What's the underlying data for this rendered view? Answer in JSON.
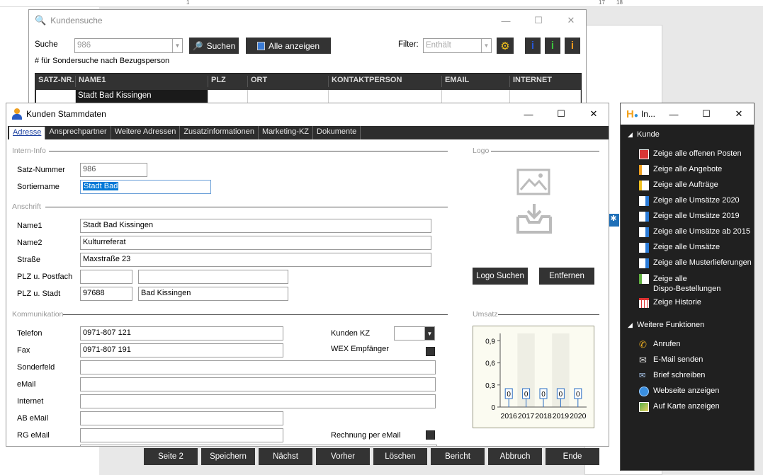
{
  "ruler": {
    "marks": [
      "1",
      "17",
      "18"
    ]
  },
  "search_window": {
    "title": "Kundensuche",
    "search_label": "Suche",
    "search_value": "986",
    "search_button": "Suchen",
    "show_all_button": "Alle anzeigen",
    "filter_label": "Filter:",
    "filter_value": "Enthält",
    "hint": "# für Sondersuche nach Bezugsperson",
    "grid": {
      "columns": [
        "SATZ-NR.",
        "NAME1",
        "PLZ",
        "ORT",
        "KONTAKTPERSON",
        "EMAIL",
        "INTERNET"
      ],
      "row": [
        "",
        "Stadt Bad Kissingen",
        "",
        "",
        "",
        "",
        ""
      ]
    }
  },
  "stamm_window": {
    "title": "Kunden Stammdaten",
    "tabs": [
      "Adresse",
      "Ansprechpartner",
      "Weitere Adressen",
      "Zusatzinformationen",
      "Marketing-KZ",
      "Dokumente"
    ],
    "sections": {
      "intern": "Intern-Info",
      "anschrift": "Anschrift",
      "kommunikation": "Kommunikation",
      "logo": "Logo",
      "umsatz": "Umsatz"
    },
    "fields": {
      "satz_nummer": {
        "label": "Satz-Nummer",
        "value": "986"
      },
      "sortiername": {
        "label": "Sortiername",
        "value": "Stadt Bad"
      },
      "name1": {
        "label": "Name1",
        "value": "Stadt Bad Kissingen"
      },
      "name2": {
        "label": "Name2",
        "value": "Kulturreferat"
      },
      "strasse": {
        "label": "Straße",
        "value": "Maxstraße 23"
      },
      "plz_postfach": {
        "label": "PLZ u. Postfach",
        "value": "",
        "value2": ""
      },
      "plz_stadt": {
        "label": "PLZ u. Stadt",
        "value": "97688",
        "value2": "Bad Kissingen"
      },
      "telefon": {
        "label": "Telefon",
        "value": "0971-807 121"
      },
      "fax": {
        "label": "Fax",
        "value": "0971-807 191"
      },
      "sonderfeld": {
        "label": "Sonderfeld",
        "value": ""
      },
      "email": {
        "label": "eMail",
        "value": ""
      },
      "internet": {
        "label": "Internet",
        "value": ""
      },
      "ab_email": {
        "label": "AB eMail",
        "value": ""
      },
      "rg_email": {
        "label": "RG eMail",
        "value": ""
      },
      "kunden_kz": {
        "label": "Kunden KZ",
        "value": ""
      },
      "wex": {
        "label": "WEX Empfänger"
      },
      "rechnung_email": {
        "label": "Rechnung per eMail"
      }
    },
    "logo_search_button": "Logo Suchen",
    "remove_button": "Entfernen"
  },
  "chart_data": {
    "type": "bar",
    "categories": [
      "2016",
      "2017",
      "2018",
      "2019",
      "2020"
    ],
    "values": [
      0,
      0,
      0,
      0,
      0
    ],
    "data_labels": [
      "0",
      "0",
      "0",
      "0",
      "0"
    ],
    "yticks": [
      "0",
      "0,3",
      "0,6",
      "0,9"
    ],
    "ylim": [
      0,
      1
    ],
    "title": "",
    "xlabel": "",
    "ylabel": ""
  },
  "bottom_bar": [
    "Seite 2",
    "Speichern",
    "Nächst",
    "Vorher",
    "Löschen",
    "Bericht",
    "Abbruch",
    "Ende"
  ],
  "info_panel": {
    "title": "In...",
    "group1": "Kunde",
    "items1": [
      "Zeige alle offenen Posten",
      "Zeige alle Angebote",
      "Zeige alle Aufträge",
      "Zeige alle Umsätze 2020",
      "Zeige alle Umsätze 2019",
      "Zeige alle Umsätze ab 2015",
      "Zeige alle Umsätze",
      "Zeige alle Musterlieferungen",
      "Zeige alle",
      "Dispo-Bestellungen",
      "Zeige Historie"
    ],
    "group2": "Weitere Funktionen",
    "items2": [
      "Anrufen",
      "E-Mail senden",
      "Brief schreiben",
      "Webseite anzeigen",
      "Auf Karte anzeigen"
    ]
  },
  "colors": {
    "dark": "#333333",
    "accent": "#0078d7",
    "panel": "#202020"
  }
}
